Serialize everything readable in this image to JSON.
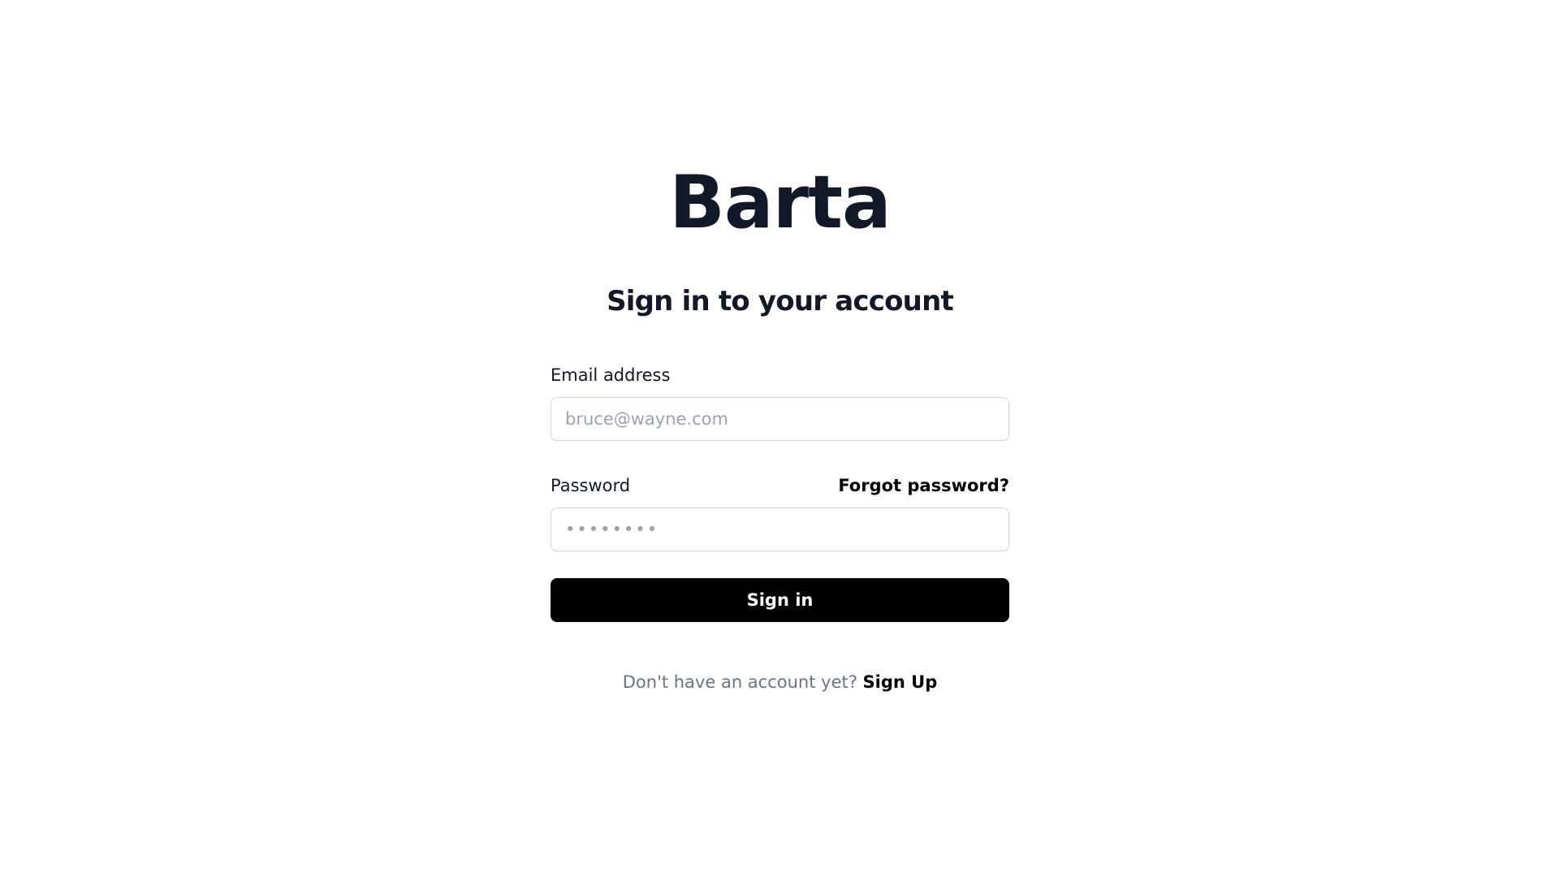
{
  "app": {
    "logo_text": "Barta"
  },
  "login": {
    "heading": "Sign in to your account",
    "email": {
      "label": "Email address",
      "placeholder": "bruce@wayne.com",
      "value": ""
    },
    "password": {
      "label": "Password",
      "placeholder": "••••••••",
      "value": "",
      "forgot_label": "Forgot password?"
    },
    "submit_label": "Sign in",
    "signup": {
      "prompt": "Don't have an account yet?",
      "link_label": "Sign Up"
    }
  },
  "colors": {
    "primary": "#000000",
    "heading_text": "#111827",
    "muted_text": "#6b7280",
    "placeholder_text": "#9ca3af",
    "input_border": "#d1d5db",
    "background": "#ffffff"
  }
}
